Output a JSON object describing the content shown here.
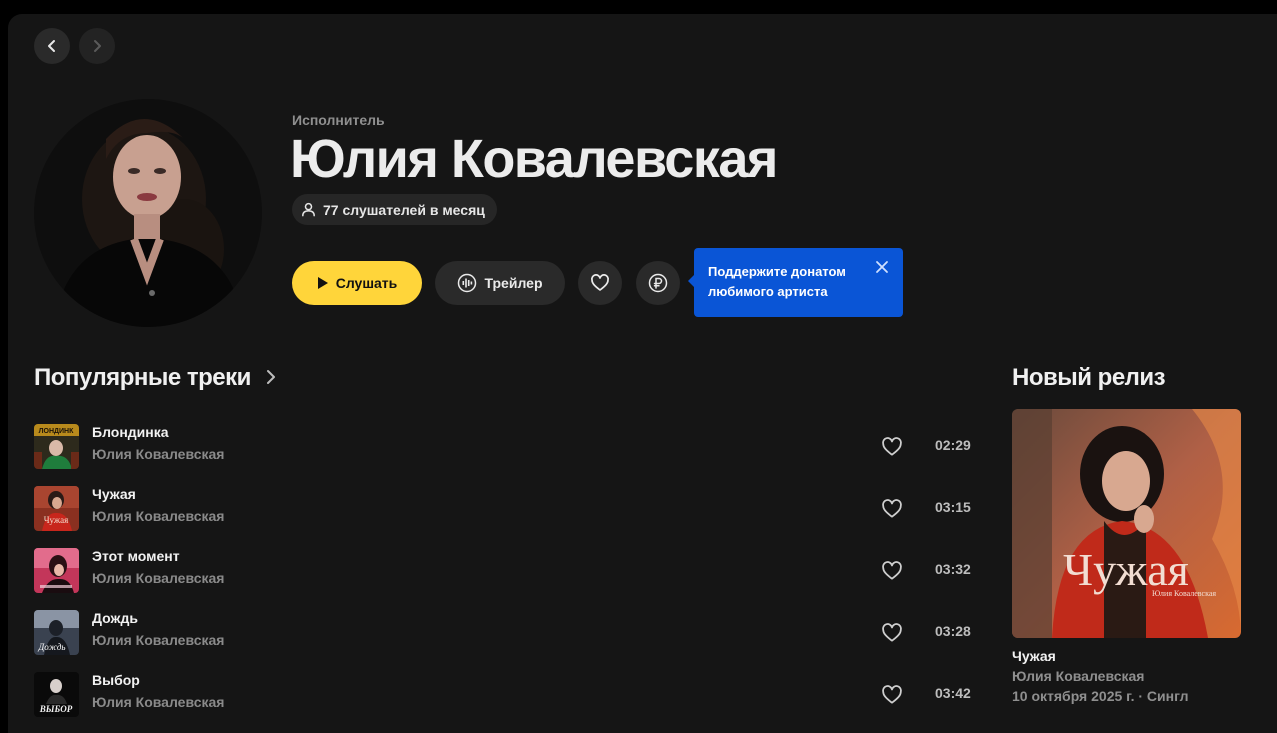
{
  "nav": {
    "back_icon": "chevron-left-icon",
    "forward_icon": "chevron-right-icon"
  },
  "artist": {
    "kicker": "Исполнитель",
    "name": "Юлия Ковалевская",
    "listeners": "77 слушателей в месяц"
  },
  "actions": {
    "play_label": "Слушать",
    "trailer_label": "Трейлер",
    "like_icon": "heart-icon",
    "donate_icon": "ruble-coin-icon"
  },
  "tooltip": {
    "text_line1": "Поддержите донатом",
    "text_line2": "любимого артиста"
  },
  "popular": {
    "heading": "Популярные треки",
    "tracks": [
      {
        "title": "Блондинка",
        "artist": "Юлия Ковалевская",
        "duration": "02:29"
      },
      {
        "title": "Чужая",
        "artist": "Юлия Ковалевская",
        "duration": "03:15"
      },
      {
        "title": "Этот момент",
        "artist": "Юлия Ковалевская",
        "duration": "03:32"
      },
      {
        "title": "Дождь",
        "artist": "Юлия Ковалевская",
        "duration": "03:28"
      },
      {
        "title": "Выбор",
        "artist": "Юлия Ковалевская",
        "duration": "03:42"
      }
    ]
  },
  "new_release": {
    "heading": "Новый релиз",
    "cover_title": "Чужая",
    "cover_artist": "Юлия Ковалевская",
    "title": "Чужая",
    "artist": "Юлия Ковалевская",
    "meta": "10 октября 2025 г. · Сингл"
  },
  "colors": {
    "accent": "#ffd53a",
    "tooltip": "#0a55d6",
    "background": "#151515"
  }
}
